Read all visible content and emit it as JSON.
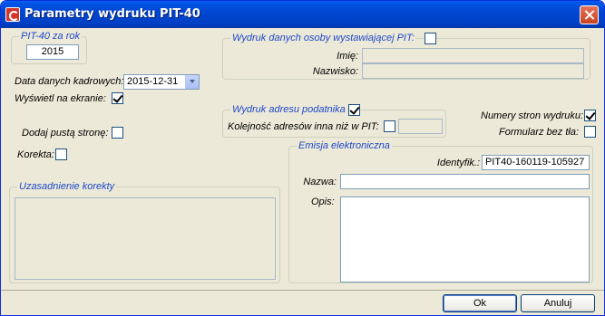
{
  "window": {
    "title": "Parametry wydruku PIT-40"
  },
  "pit_year": {
    "legend": "PIT-40 za rok",
    "value": "2015"
  },
  "staff_date": {
    "label": "Data danych kadrowych:",
    "value": "2015-12-31"
  },
  "show_on_screen": {
    "label": "Wyświetl na ekranie:",
    "checked": true
  },
  "add_blank_page": {
    "label": "Dodaj pustą stronę:",
    "checked": false
  },
  "correction": {
    "label": "Korekta:",
    "checked": false
  },
  "correction_reason": {
    "legend": "Uzasadnienie korekty"
  },
  "issuer": {
    "legend": "Wydruk danych osoby wystawiającej PIT:",
    "checked": false,
    "first_name_label": "Imię:",
    "last_name_label": "Nazwisko:"
  },
  "taxpayer_address": {
    "legend": "Wydruk adresu podatnika",
    "checked": true,
    "order_label": "Kolejność adresów inna niż w PIT:",
    "order_checked": false
  },
  "page_numbers": {
    "label": "Numery stron wydruku:",
    "checked": true
  },
  "no_background": {
    "label": "Formularz bez tła:",
    "checked": false
  },
  "e_emission": {
    "legend": "Emisja elektroniczna",
    "identifier_label": "Identyfik.:",
    "identifier_value": "PIT40-160119-105927",
    "name_label": "Nazwa:",
    "name_value": "",
    "description_label": "Opis:"
  },
  "buttons": {
    "ok": "Ok",
    "cancel": "Anuluj"
  }
}
